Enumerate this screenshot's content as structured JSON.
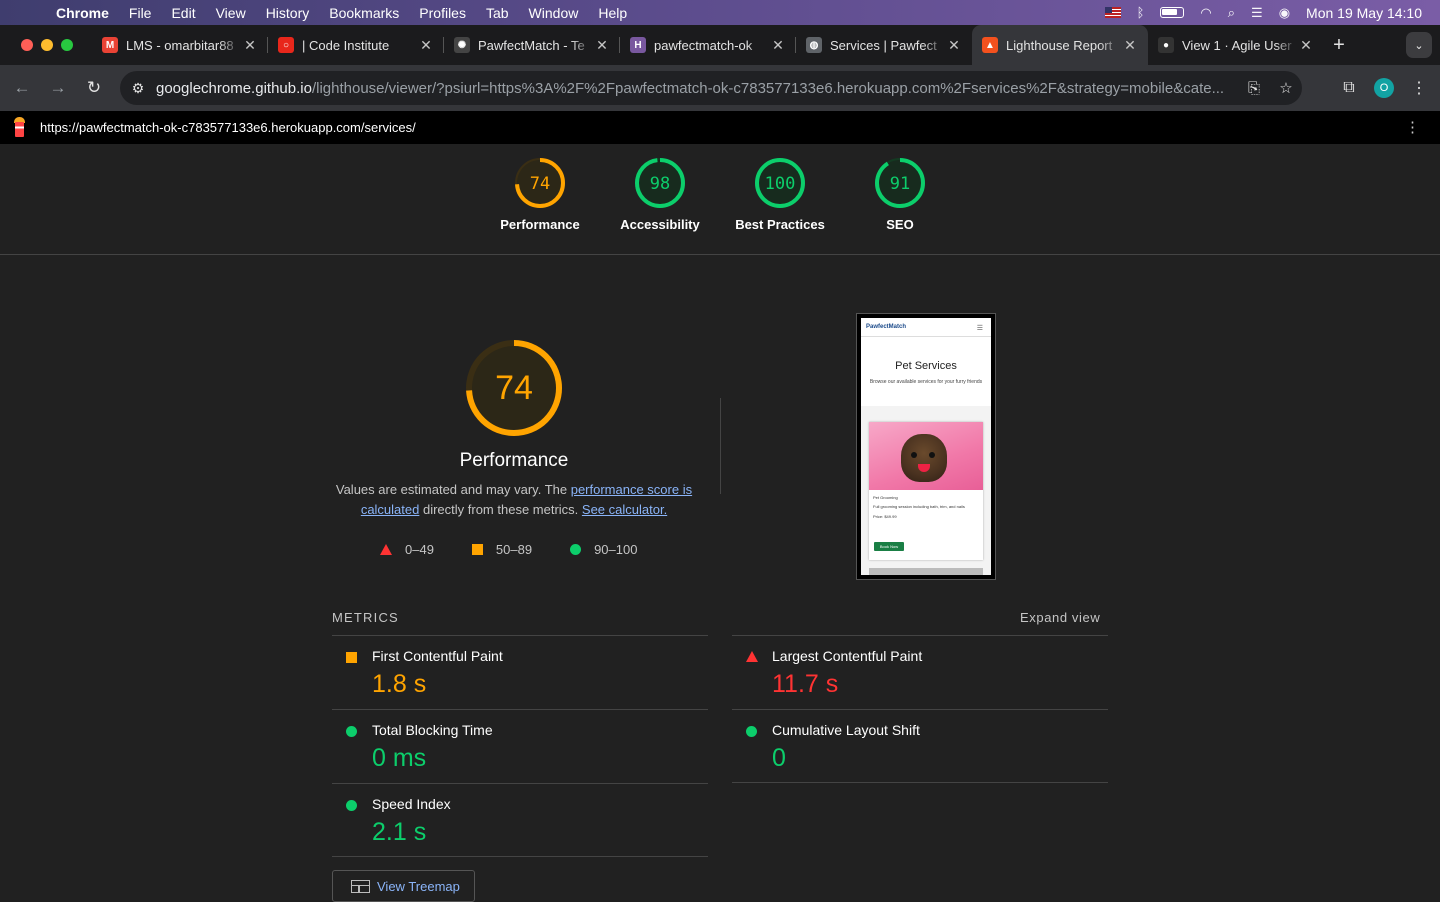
{
  "menubar": {
    "app": "Chrome",
    "items": [
      "File",
      "Edit",
      "View",
      "History",
      "Bookmarks",
      "Profiles",
      "Tab",
      "Window",
      "Help"
    ],
    "datetime": "Mon 19 May  14:10"
  },
  "tabs": [
    {
      "title": "LMS - omarbitar88",
      "favicon": "gmail-icon",
      "color": "#ea4335",
      "glyph": "M"
    },
    {
      "title": "| Code Institute",
      "favicon": "code-institute-icon",
      "color": "#e8271b",
      "glyph": "○"
    },
    {
      "title": "PawfectMatch - Te",
      "favicon": "chatgpt-icon",
      "color": "#444444",
      "glyph": "✺"
    },
    {
      "title": "pawfectmatch-ok",
      "favicon": "heroku-icon",
      "color": "#79589f",
      "glyph": "H"
    },
    {
      "title": "Services | Pawfect",
      "favicon": "globe-icon",
      "color": "#5f6368",
      "glyph": "◍"
    },
    {
      "title": "Lighthouse Report",
      "favicon": "lighthouse-icon",
      "color": "#f4511e",
      "glyph": "▲"
    },
    {
      "title": "View 1 · Agile User",
      "favicon": "github-icon",
      "color": "#333333",
      "glyph": "●"
    }
  ],
  "active_tab_index": 5,
  "address_bar": {
    "host": "googlechrome.github.io",
    "path": "/lighthouse/viewer/?psiurl=https%3A%2F%2Fpawfectmatch-ok-c783577133e6.herokuapp.com%2Fservices%2F&strategy=mobile&cate..."
  },
  "profile_initial": "O",
  "lighthouse": {
    "report_url": "https://pawfectmatch-ok-c783577133e6.herokuapp.com/services/",
    "categories": [
      {
        "label": "Performance",
        "score": 74,
        "color": "#ffa400"
      },
      {
        "label": "Accessibility",
        "score": 98,
        "color": "#0cce6b"
      },
      {
        "label": "Best Practices",
        "score": 100,
        "color": "#0cce6b"
      },
      {
        "label": "SEO",
        "score": 91,
        "color": "#0cce6b"
      }
    ],
    "performance": {
      "score": 74,
      "title": "Performance",
      "desc_prefix": "Values are estimated and may vary. The ",
      "link1": "performance score is calculated",
      "desc_middle": " directly from these metrics. ",
      "link2": "See calculator."
    },
    "legend": [
      "0–49",
      "50–89",
      "90–100"
    ],
    "screenshot": {
      "brand": "PawfectMatch",
      "title": "Pet Services",
      "subtitle": "Browse our available services for your furry friends",
      "card_title": "Pet Grooming",
      "card_desc": "Full grooming session including bath, trim, and nails",
      "card_price": "Price: $49.99",
      "card_button": "Book Now"
    },
    "metrics_header": "METRICS",
    "expand_label": "Expand view",
    "metrics": [
      {
        "name": "First Contentful Paint",
        "value": "1.8 s",
        "rating": "average"
      },
      {
        "name": "Largest Contentful Paint",
        "value": "11.7 s",
        "rating": "fail"
      },
      {
        "name": "Total Blocking Time",
        "value": "0 ms",
        "rating": "pass"
      },
      {
        "name": "Cumulative Layout Shift",
        "value": "0",
        "rating": "pass"
      },
      {
        "name": "Speed Index",
        "value": "2.1 s",
        "rating": "pass"
      }
    ],
    "treemap_label": "View Treemap"
  }
}
